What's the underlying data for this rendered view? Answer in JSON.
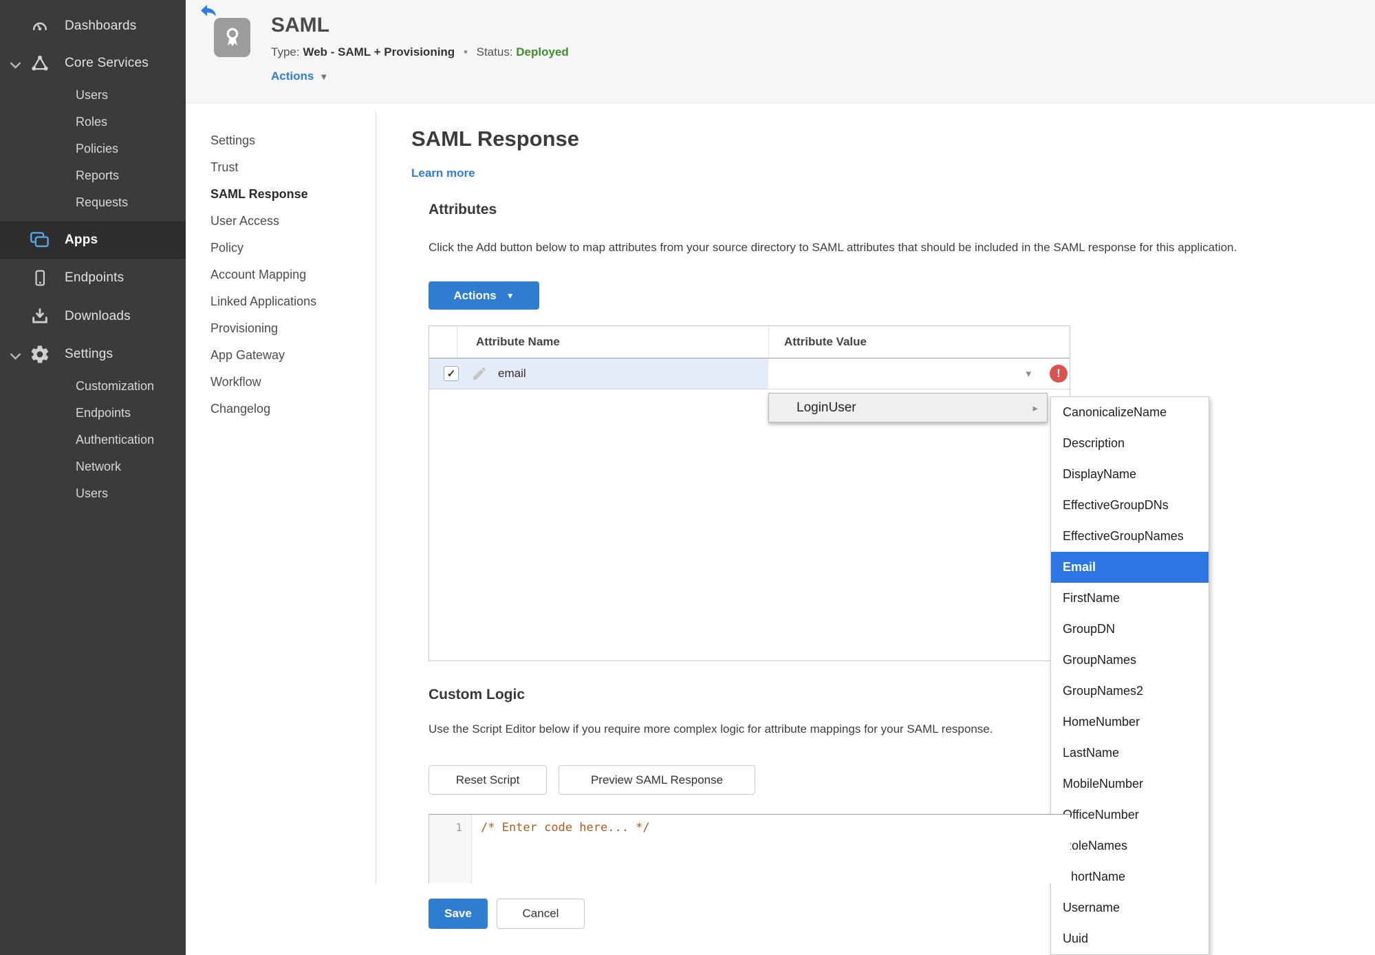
{
  "icons": {
    "caret_down": "▼",
    "caret_small": "▾",
    "arrow_right": "▸",
    "bullet": "•",
    "check": "✓",
    "exclamation": "!"
  },
  "sidebar": {
    "dashboards": "Dashboards",
    "core_services": "Core Services",
    "core_children": [
      "Users",
      "Roles",
      "Policies",
      "Reports",
      "Requests"
    ],
    "apps": "Apps",
    "endpoints": "Endpoints",
    "downloads": "Downloads",
    "settings": "Settings",
    "settings_children": [
      "Customization",
      "Endpoints",
      "Authentication",
      "Network",
      "Users"
    ]
  },
  "header": {
    "app_title": "SAML",
    "type_label": "Type:",
    "type_value": "Web - SAML + Provisioning",
    "status_label": "Status:",
    "status_value": "Deployed",
    "actions_label": "Actions"
  },
  "subnav": [
    "Settings",
    "Trust",
    "SAML Response",
    "User Access",
    "Policy",
    "Account Mapping",
    "Linked Applications",
    "Provisioning",
    "App Gateway",
    "Workflow",
    "Changelog"
  ],
  "page": {
    "title": "SAML Response",
    "learn_more": "Learn more"
  },
  "attributes": {
    "heading": "Attributes",
    "description": "Click the Add button below to map attributes from your source directory to SAML attributes that should be included in the SAML response for this application.",
    "actions_button": "Actions",
    "table": {
      "col_name": "Attribute Name",
      "col_value": "Attribute Value",
      "row": {
        "name": "email",
        "value": ""
      }
    }
  },
  "value_menu": {
    "root": "LoginUser",
    "selected": "Email",
    "items": [
      "CanonicalizeName",
      "Description",
      "DisplayName",
      "EffectiveGroupDNs",
      "EffectiveGroupNames",
      "Email",
      "FirstName",
      "GroupDN",
      "GroupNames",
      "GroupNames2",
      "HomeNumber",
      "LastName",
      "MobileNumber",
      "OfficeNumber",
      "RoleNames",
      "ShortName",
      "Username",
      "Uuid"
    ]
  },
  "custom_logic": {
    "heading": "Custom Logic",
    "description": "Use the Script Editor below if you require more complex logic for attribute mappings for your SAML response.",
    "reset_button": "Reset Script",
    "preview_button": "Preview SAML Response",
    "line_number": "1",
    "code": "/* Enter code here... */"
  },
  "footer": {
    "save": "Save",
    "cancel": "Cancel"
  },
  "colors": {
    "accent_blue": "#2e7dd1",
    "link_blue": "#2b7de1",
    "status_green": "#3e8e2d",
    "error_red": "#d9534f",
    "menu_selected_blue": "#2b76e3",
    "sidebar_bg": "#3b3b3b",
    "row_highlight": "#e3ecf8"
  }
}
